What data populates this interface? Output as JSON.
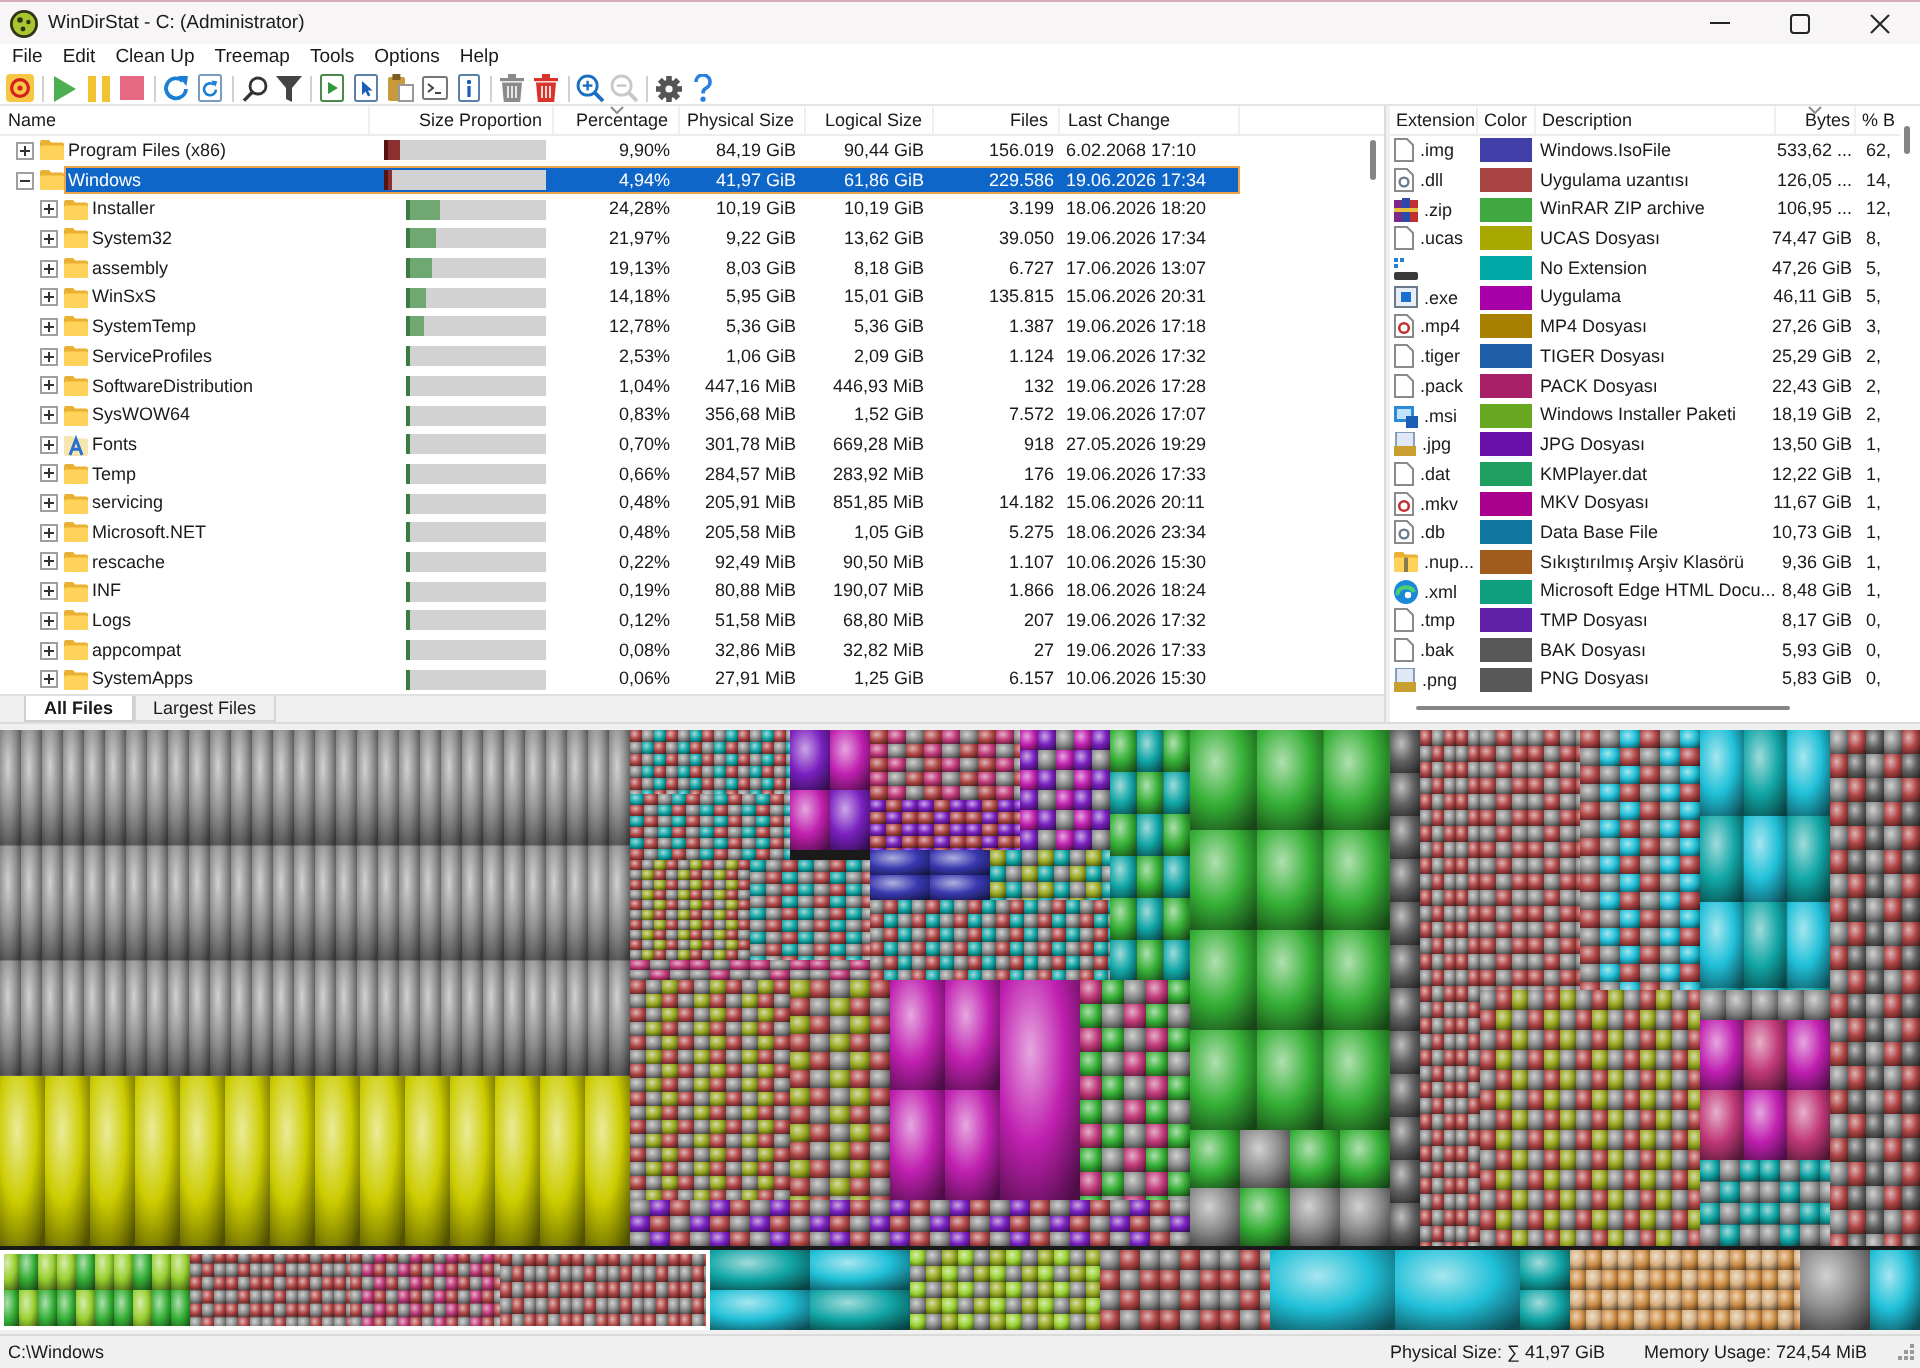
{
  "window": {
    "title": "WinDirStat - C: (Administrator)"
  },
  "menu": [
    "File",
    "Edit",
    "Clean Up",
    "Treemap",
    "Tools",
    "Options",
    "Help"
  ],
  "toolbar": [
    [
      {
        "kind": "select-drive",
        "disabled": false
      }
    ],
    [
      {
        "kind": "resume",
        "disabled": false
      },
      {
        "kind": "pause",
        "disabled": false
      },
      {
        "kind": "stop",
        "disabled": false
      }
    ],
    [
      {
        "kind": "refresh-all",
        "disabled": false
      },
      {
        "kind": "refresh-selected",
        "disabled": false
      }
    ],
    [
      {
        "kind": "find",
        "disabled": false
      },
      {
        "kind": "filter",
        "disabled": false
      }
    ],
    [
      {
        "kind": "open-item",
        "disabled": false
      },
      {
        "kind": "select-item",
        "disabled": false
      },
      {
        "kind": "copy-path",
        "disabled": false
      },
      {
        "kind": "command-prompt",
        "disabled": false
      },
      {
        "kind": "properties",
        "disabled": false
      }
    ],
    [
      {
        "kind": "recycle",
        "disabled": false
      },
      {
        "kind": "delete",
        "disabled": false
      }
    ],
    [
      {
        "kind": "zoom-in",
        "disabled": false
      },
      {
        "kind": "zoom-out",
        "disabled": true
      }
    ],
    [
      {
        "kind": "settings",
        "disabled": false
      },
      {
        "kind": "help",
        "disabled": false
      }
    ]
  ],
  "tree": {
    "columns": [
      {
        "label": "Name",
        "sorted": false
      },
      {
        "label": "Size Proportion",
        "sorted": false
      },
      {
        "label": "Percentage",
        "sorted": true
      },
      {
        "label": "Physical Size",
        "sorted": false
      },
      {
        "label": "Logical Size",
        "sorted": false
      },
      {
        "label": "Files",
        "sorted": false
      },
      {
        "label": "Last Change",
        "sorted": false
      }
    ],
    "rows": [
      {
        "name": "Program Files (x86)",
        "kind": "folder",
        "expanded": false,
        "selected": false,
        "level": 0.099,
        "percentage": "9,90%",
        "physical_size": "84,19 GiB",
        "logical_size": "90,44 GiB",
        "files": "156.019",
        "last_change": "6.02.2068 17:10"
      },
      {
        "name": "Windows",
        "kind": "folder",
        "expanded": true,
        "selected": true,
        "level": 0.0494,
        "percentage": "4,94%",
        "physical_size": "41,97 GiB",
        "logical_size": "61,86 GiB",
        "files": "229.586",
        "last_change": "19.06.2026 17:34",
        "children": [
          {
            "name": "Installer",
            "kind": "folder",
            "expanded": false,
            "selected": false,
            "level": 0.2428,
            "percentage": "24,28%",
            "physical_size": "10,19 GiB",
            "logical_size": "10,19 GiB",
            "files": "3.199",
            "last_change": "18.06.2026 18:20"
          },
          {
            "name": "System32",
            "kind": "folder",
            "expanded": false,
            "selected": false,
            "level": 0.2197,
            "percentage": "21,97%",
            "physical_size": "9,22 GiB",
            "logical_size": "13,62 GiB",
            "files": "39.050",
            "last_change": "19.06.2026 17:34"
          },
          {
            "name": "assembly",
            "kind": "folder",
            "expanded": false,
            "selected": false,
            "level": 0.1913,
            "percentage": "19,13%",
            "physical_size": "8,03 GiB",
            "logical_size": "8,18 GiB",
            "files": "6.727",
            "last_change": "17.06.2026 13:07"
          },
          {
            "name": "WinSxS",
            "kind": "folder",
            "expanded": false,
            "selected": false,
            "level": 0.1418,
            "percentage": "14,18%",
            "physical_size": "5,95 GiB",
            "logical_size": "15,01 GiB",
            "files": "135.815",
            "last_change": "15.06.2026 20:31"
          },
          {
            "name": "SystemTemp",
            "kind": "folder",
            "expanded": false,
            "selected": false,
            "level": 0.1278,
            "percentage": "12,78%",
            "physical_size": "5,36 GiB",
            "logical_size": "5,36 GiB",
            "files": "1.387",
            "last_change": "19.06.2026 17:18"
          },
          {
            "name": "ServiceProfiles",
            "kind": "folder",
            "expanded": false,
            "selected": false,
            "level": 0.0253,
            "percentage": "2,53%",
            "physical_size": "1,06 GiB",
            "logical_size": "2,09 GiB",
            "files": "1.124",
            "last_change": "19.06.2026 17:32"
          },
          {
            "name": "SoftwareDistribution",
            "kind": "folder",
            "expanded": false,
            "selected": false,
            "level": 0.0104,
            "percentage": "1,04%",
            "physical_size": "447,16 MiB",
            "logical_size": "446,93 MiB",
            "files": "132",
            "last_change": "19.06.2026 17:28"
          },
          {
            "name": "SysWOW64",
            "kind": "folder",
            "expanded": false,
            "selected": false,
            "level": 0.0083,
            "percentage": "0,83%",
            "physical_size": "356,68 MiB",
            "logical_size": "1,52 GiB",
            "files": "7.572",
            "last_change": "19.06.2026 17:07"
          },
          {
            "name": "Fonts",
            "kind": "fonts",
            "expanded": false,
            "selected": false,
            "level": 0.007,
            "percentage": "0,70%",
            "physical_size": "301,78 MiB",
            "logical_size": "669,28 MiB",
            "files": "918",
            "last_change": "27.05.2026 19:29"
          },
          {
            "name": "Temp",
            "kind": "folder",
            "expanded": false,
            "selected": false,
            "level": 0.0066,
            "percentage": "0,66%",
            "physical_size": "284,57 MiB",
            "logical_size": "283,92 MiB",
            "files": "176",
            "last_change": "19.06.2026 17:33"
          },
          {
            "name": "servicing",
            "kind": "folder",
            "expanded": false,
            "selected": false,
            "level": 0.0048,
            "percentage": "0,48%",
            "physical_size": "205,91 MiB",
            "logical_size": "851,85 MiB",
            "files": "14.182",
            "last_change": "15.06.2026 20:11"
          },
          {
            "name": "Microsoft.NET",
            "kind": "folder",
            "expanded": false,
            "selected": false,
            "level": 0.0048,
            "percentage": "0,48%",
            "physical_size": "205,58 MiB",
            "logical_size": "1,05 GiB",
            "files": "5.275",
            "last_change": "18.06.2026 23:34"
          },
          {
            "name": "rescache",
            "kind": "folder",
            "expanded": false,
            "selected": false,
            "level": 0.0022,
            "percentage": "0,22%",
            "physical_size": "92,49 MiB",
            "logical_size": "90,50 MiB",
            "files": "1.107",
            "last_change": "10.06.2026 15:30"
          },
          {
            "name": "INF",
            "kind": "folder",
            "expanded": false,
            "selected": false,
            "level": 0.0019,
            "percentage": "0,19%",
            "physical_size": "80,88 MiB",
            "logical_size": "190,07 MiB",
            "files": "1.866",
            "last_change": "18.06.2026 18:24"
          },
          {
            "name": "Logs",
            "kind": "folder",
            "expanded": false,
            "selected": false,
            "level": 0.0012,
            "percentage": "0,12%",
            "physical_size": "51,58 MiB",
            "logical_size": "68,80 MiB",
            "files": "207",
            "last_change": "19.06.2026 17:32"
          },
          {
            "name": "appcompat",
            "kind": "folder",
            "expanded": false,
            "selected": false,
            "level": 0.0008,
            "percentage": "0,08%",
            "physical_size": "32,86 MiB",
            "logical_size": "32,82 MiB",
            "files": "27",
            "last_change": "19.06.2026 17:33"
          },
          {
            "name": "SystemApps",
            "kind": "folder",
            "expanded": false,
            "selected": false,
            "level": 0.0006,
            "percentage": "0,06%",
            "physical_size": "27,91 MiB",
            "logical_size": "1,25 GiB",
            "files": "6.157",
            "last_change": "10.06.2026 15:30"
          }
        ]
      }
    ]
  },
  "tabs": [
    {
      "label": "All Files",
      "selected": true
    },
    {
      "label": "Largest Files",
      "selected": false
    }
  ],
  "extensions": {
    "columns": [
      {
        "label": "Extension",
        "sorted": false
      },
      {
        "label": "Color",
        "sorted": false
      },
      {
        "label": "Description",
        "sorted": false
      },
      {
        "label": "Bytes",
        "sorted": true
      },
      {
        "label": "% B",
        "sorted": false
      }
    ],
    "rows": [
      {
        "kind": "file",
        "extension": ".img",
        "color": "#4040a8",
        "description": "Windows.IsoFile",
        "bytes": "533,62 ...",
        "percent": "62,",
        "selected": false
      },
      {
        "kind": "settings-file",
        "extension": ".dll",
        "color": "#a84444",
        "description": "Uygulama uzantısı",
        "bytes": "126,05 ...",
        "percent": "14,",
        "selected": false
      },
      {
        "kind": "archive",
        "extension": ".zip",
        "color": "#40a840",
        "description": "WinRAR ZIP archive",
        "bytes": "106,95 ...",
        "percent": "12,",
        "selected": false
      },
      {
        "kind": "file",
        "extension": ".ucas",
        "color": "#a8a800",
        "description": "UCAS Dosyası",
        "bytes": "74,47 GiB",
        "percent": "8,",
        "selected": false
      },
      {
        "kind": "drive",
        "color": "#00a8a8",
        "description": "No Extension",
        "bytes": "47,26 GiB",
        "percent": "5,",
        "selected": false
      },
      {
        "kind": "app",
        "extension": ".exe",
        "color": "#a800a8",
        "description": "Uygulama",
        "bytes": "46,11 GiB",
        "percent": "5,",
        "selected": false
      },
      {
        "kind": "media",
        "extension": ".mp4",
        "color": "#a88000",
        "description": "MP4 Dosyası",
        "bytes": "27,26 GiB",
        "percent": "3,",
        "selected": false
      },
      {
        "kind": "file",
        "extension": ".tiger",
        "color": "#2060a8",
        "description": "TIGER Dosyası",
        "bytes": "25,29 GiB",
        "percent": "2,",
        "selected": false
      },
      {
        "kind": "file",
        "extension": ".pack",
        "color": "#a82068",
        "description": "PACK Dosyası",
        "bytes": "22,43 GiB",
        "percent": "2,",
        "selected": false
      },
      {
        "kind": "installer",
        "extension": ".msi",
        "color": "#68a820",
        "description": "Windows Installer Paketi",
        "bytes": "18,19 GiB",
        "percent": "2,",
        "selected": false
      },
      {
        "kind": "image",
        "extension": ".jpg",
        "color": "#6810a8",
        "description": "JPG Dosyası",
        "bytes": "13,50 GiB",
        "percent": "1,",
        "selected": false
      },
      {
        "kind": "file",
        "extension": ".dat",
        "color": "#20a060",
        "description": "KMPlayer.dat",
        "bytes": "12,22 GiB",
        "percent": "1,",
        "selected": false
      },
      {
        "kind": "media",
        "extension": ".mkv",
        "color": "#a8008c",
        "description": "MKV Dosyası",
        "bytes": "11,67 GiB",
        "percent": "1,",
        "selected": false
      },
      {
        "kind": "settings-file",
        "extension": ".db",
        "color": "#1078a0",
        "description": "Data Base File",
        "bytes": "10,73 GiB",
        "percent": "1,",
        "selected": false
      },
      {
        "kind": "zip-folder",
        "extension": ".nup...",
        "color": "#a05c1c",
        "description": "Sıkıştırılmış Arşiv Klasörü",
        "bytes": "9,36 GiB",
        "percent": "1,",
        "selected": false
      },
      {
        "kind": "browser",
        "extension": ".xml",
        "color": "#10a080",
        "description": "Microsoft Edge HTML Docu...",
        "bytes": "8,48 GiB",
        "percent": "1,",
        "selected": false
      },
      {
        "kind": "file",
        "extension": ".tmp",
        "color": "#6020a8",
        "description": "TMP Dosyası",
        "bytes": "8,17 GiB",
        "percent": "0,",
        "selected": false
      },
      {
        "kind": "file",
        "extension": ".bak",
        "color": "#585858",
        "description": "BAK Dosyası",
        "bytes": "5,93 GiB",
        "percent": "0,",
        "selected": false
      },
      {
        "kind": "image",
        "extension": ".png",
        "color": "#585858",
        "description": "PNG Dosyası",
        "bytes": "5,83 GiB",
        "percent": "0,",
        "selected": false
      }
    ]
  },
  "status_bar": {
    "path": "C:\\Windows",
    "physical_size": "Physical Size: ∑ 41,97 GiB",
    "memory_usage": "Memory Usage: 724,54 MiB"
  }
}
